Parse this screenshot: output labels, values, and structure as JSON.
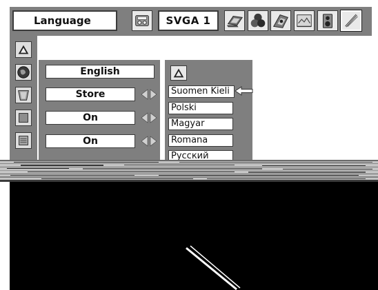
{
  "menu": {
    "title": "Language",
    "input_source": "SVGA 1"
  },
  "toolbar_icons": [
    "input-source-icon",
    "pc-adjust-icon",
    "color-adjust-icon",
    "image-adjust-icon",
    "screen-icon",
    "sound-icon",
    "setting-icon"
  ],
  "settings": {
    "current_language": "English",
    "store_label": "Store",
    "option_1": "On",
    "option_2": "On"
  },
  "language_list": [
    "Suomen Kieli",
    "Polski",
    "Magyar",
    "Romana",
    "Русский"
  ],
  "colors": {
    "menu_background": "#7f7f7f",
    "field_background": "#ffffff",
    "selected_border": "#ffffff"
  }
}
